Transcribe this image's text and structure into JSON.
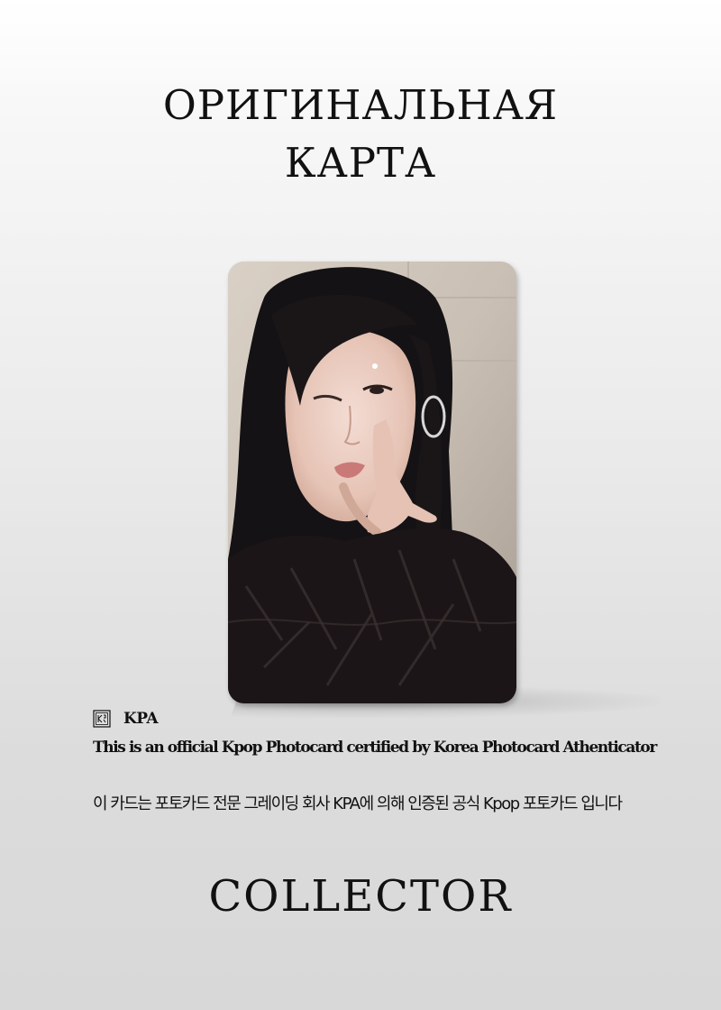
{
  "header": {
    "title_line1": "ОРИГИНАЛЬНАЯ",
    "title_line2": "КАРТА"
  },
  "photocard": {
    "image": "photo of a person with long black hair winking and making a peace sign"
  },
  "certificate": {
    "logo_icon": "kpa-logo-icon",
    "brand": "KPA",
    "english_text": "This is an official Kpop Photocard certified by Korea Photocard Athenticator",
    "korean_text": "이 카드는 포토카드 전문 그레이딩 회사 KPA에 의해 인증된 공식 Kpop 포토카드 입니다"
  },
  "footer": {
    "label": "COLLECTOR"
  }
}
